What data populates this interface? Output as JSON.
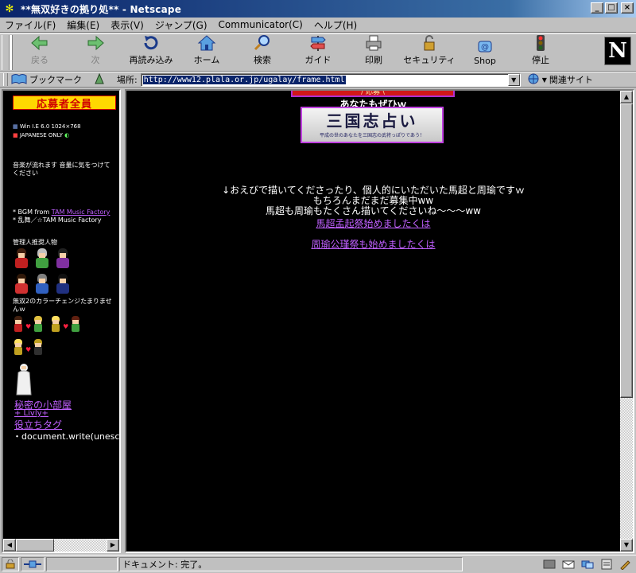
{
  "window": {
    "title": "**無双好きの拠り処** - Netscape"
  },
  "menu": [
    "ファイル(F)",
    "編集(E)",
    "表示(V)",
    "ジャンプ(G)",
    "Communicator(C)",
    "ヘルプ(H)"
  ],
  "toolbar": {
    "back": "戻る",
    "forward": "次",
    "reload": "再読み込み",
    "home": "ホーム",
    "search": "検索",
    "guide": "ガイド",
    "print": "印刷",
    "security": "セキュリティ",
    "shop": "Shop",
    "stop": "停止",
    "logo_letter": "N"
  },
  "location": {
    "bookmarks": "ブックマーク",
    "label": "場所:",
    "url": "http://www12.plala.or.jp/ugalay/frame.html",
    "related": "関連サイト"
  },
  "left_frame": {
    "banner": "応募者全員",
    "spec_line": "Win I.E 6.0 1024×768",
    "lang_line": "JAPANESE ONLY",
    "audio_note": "音楽が流れます 音量に気をつけてください",
    "bgm_prefix": "* BGM from ",
    "bgm_link": "TAM Music Factory",
    "bgm_suffix": " * 乱舞／☆TAM Music Factory",
    "recommend_title": "管理人推奨人物",
    "color_change": "無双2のカラーチェンジたまりませんｗ",
    "link1": "秘密の小部屋",
    "link2": "+ Livly+",
    "link3": "役立ちタグ",
    "code": "・document.write(unesca"
  },
  "main_frame": {
    "top_banner": "/ 応募 \\",
    "you_too": "あなたもぜひｗ",
    "uranai_title": "三国志占い",
    "uranai_sub": "平成の世のあなたを三国志の武将っぽりであう！",
    "line1": "↓おえびで描いてくださったり、個人的にいただいた馬超と周瑜ですｗ",
    "line2": "もちろんまだまだ募集中ww",
    "line3": "馬超も周瑜もたくさん描いてくださいね～～～ww",
    "link1": "馬超孟起祭始めましたくは",
    "link2": "周瑜公瑾祭も始めましたくは"
  },
  "status": {
    "text": "ドキュメント: 完了。"
  },
  "colors": {
    "title_gradient_start": "#0a246a",
    "link": "#c060ff",
    "frame_bg": "#000000",
    "chrome": "#c0c0c0"
  }
}
